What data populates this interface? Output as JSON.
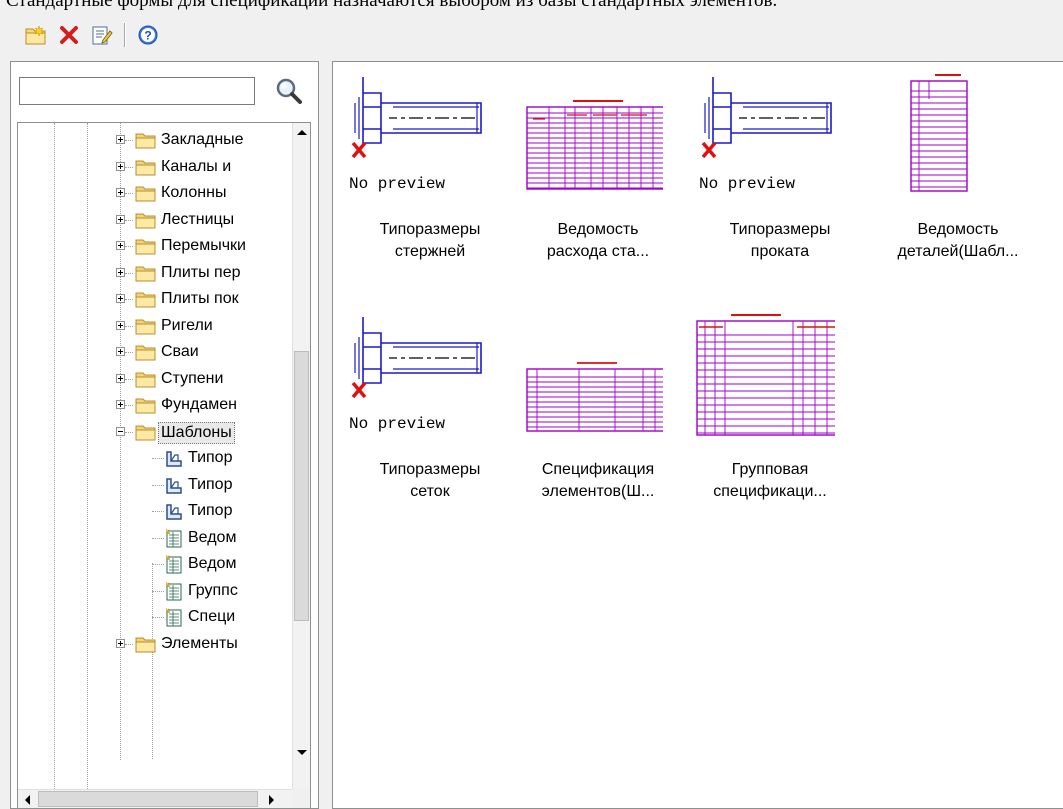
{
  "caption": "Стандартные формы для спецификации назначаются выбором из базы стандартных элементов.",
  "toolbar": {
    "buttons": [
      {
        "icon": "new-folder-icon"
      },
      {
        "icon": "delete-icon"
      },
      {
        "icon": "properties-icon"
      },
      {
        "icon": "help-icon"
      }
    ]
  },
  "search": {
    "value": "",
    "placeholder": ""
  },
  "tree": {
    "folders": [
      {
        "label": "Закладные",
        "expanded": false
      },
      {
        "label": "Каналы и",
        "expanded": false
      },
      {
        "label": "Колонны",
        "expanded": false
      },
      {
        "label": "Лестницы",
        "expanded": false
      },
      {
        "label": "Перемычки",
        "expanded": false
      },
      {
        "label": "Плиты пер",
        "expanded": false
      },
      {
        "label": "Плиты пок",
        "expanded": false
      },
      {
        "label": "Ригели",
        "expanded": false
      },
      {
        "label": "Сваи",
        "expanded": false
      },
      {
        "label": "Ступени",
        "expanded": false
      },
      {
        "label": "Фундамен",
        "expanded": false
      },
      {
        "label": "Шаблоны",
        "expanded": true
      }
    ],
    "children": [
      {
        "label": "Типор",
        "icon": "profile-icon"
      },
      {
        "label": "Типор",
        "icon": "profile-icon"
      },
      {
        "label": "Типор",
        "icon": "profile-icon"
      },
      {
        "label": "Ведом",
        "icon": "table-template-icon"
      },
      {
        "label": "Ведом",
        "icon": "table-template-icon"
      },
      {
        "label": "Группс",
        "icon": "table-template-icon"
      },
      {
        "label": "Специ",
        "icon": "table-template-icon"
      }
    ],
    "last_folder": {
      "label": "Элементы",
      "expanded": false
    }
  },
  "thumbnails": {
    "no_preview": "No preview",
    "items": [
      {
        "label_line1": "Типоразмеры",
        "label_line2": "стержней",
        "preview": "no-preview"
      },
      {
        "label_line1": "Ведомость",
        "label_line2": "расхода ста...",
        "preview": "table"
      },
      {
        "label_line1": "Типоразмеры",
        "label_line2": "проката",
        "preview": "no-preview"
      },
      {
        "label_line1": "Ведомость",
        "label_line2": "деталей(Шабл...",
        "preview": "table"
      },
      {
        "label_line1": "Типоразмеры",
        "label_line2": "сеток",
        "preview": "no-preview"
      },
      {
        "label_line1": "Спецификация",
        "label_line2": "элементов(Ш...",
        "preview": "table"
      },
      {
        "label_line1": "Групповая",
        "label_line2": "спецификаци...",
        "preview": "table"
      }
    ]
  },
  "colors": {
    "preview_bolt": "#1a1acc",
    "preview_table": "#a000c8",
    "preview_red": "#dd1111"
  }
}
